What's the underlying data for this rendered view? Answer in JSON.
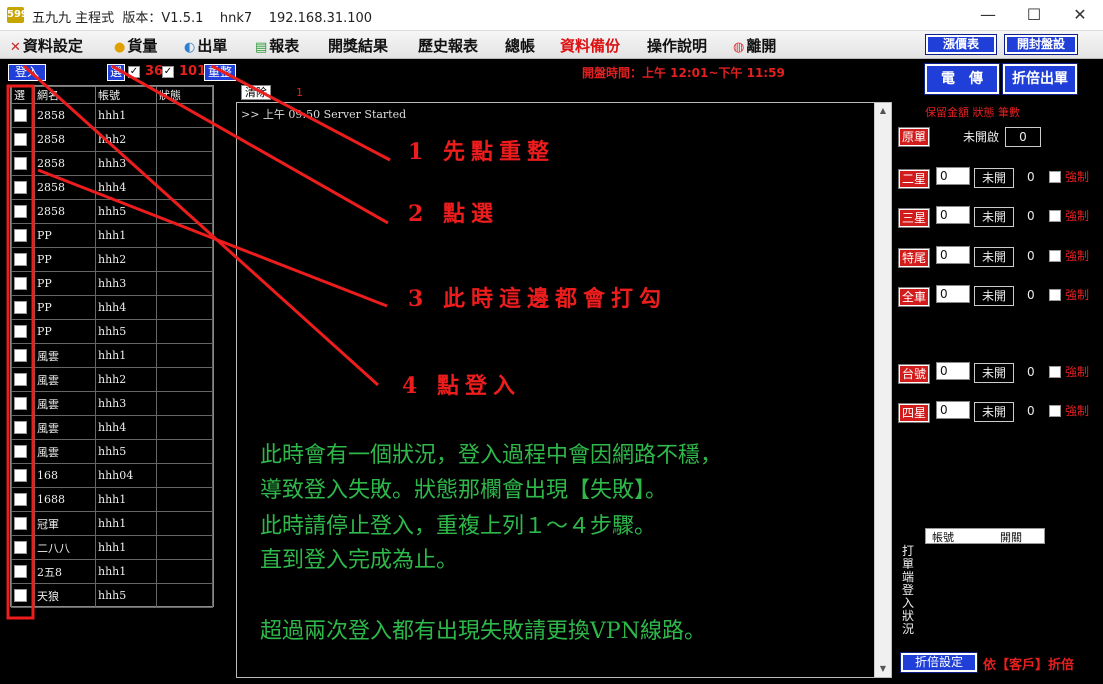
{
  "window": {
    "title": "五九九 主程式  版本：V1.5.1    hnk7    192.168.31.100",
    "app_icon": "599"
  },
  "menu": [
    {
      "label": "資料設定",
      "icon": "✕",
      "icon_color": "#c62828"
    },
    {
      "label": "貨量",
      "icon": "●",
      "icon_color": "#e0a000"
    },
    {
      "label": "出單",
      "icon": "◐",
      "icon_color": "#2d7fd3"
    },
    {
      "label": "報表",
      "icon": "▤",
      "icon_color": "#2e9b3a"
    },
    {
      "label": "開獎結果",
      "icon": "",
      "icon_color": ""
    },
    {
      "label": "歷史報表",
      "icon": "",
      "icon_color": ""
    },
    {
      "label": "總帳",
      "icon": "",
      "icon_color": ""
    },
    {
      "label": "資料備份",
      "icon": "",
      "icon_color": "",
      "color": "#d11"
    },
    {
      "label": "操作說明",
      "icon": "",
      "icon_color": ""
    },
    {
      "label": "離開",
      "icon": "◍",
      "icon_color": "#d33"
    }
  ],
  "top_right_buttons": {
    "limit_table": "漲價表",
    "seal_settings": "開封盤設"
  },
  "toolbar": {
    "login": "登入",
    "select": "選",
    "count_a": "36",
    "count_b": "101",
    "refresh": "重整",
    "clear": "清除",
    "clear_count": "1",
    "open_time": "開盤時間：上午 12:01~下午 11:59"
  },
  "grid": {
    "headers": [
      "選",
      "網名",
      "帳號",
      "狀態"
    ],
    "rows": [
      {
        "site": "2858",
        "account": "hhh1",
        "status": ""
      },
      {
        "site": "2858",
        "account": "hhh2",
        "status": ""
      },
      {
        "site": "2858",
        "account": "hhh3",
        "status": ""
      },
      {
        "site": "2858",
        "account": "hhh4",
        "status": ""
      },
      {
        "site": "2858",
        "account": "hhh5",
        "status": ""
      },
      {
        "site": "PP",
        "account": "hhh1",
        "status": ""
      },
      {
        "site": "PP",
        "account": "hhh2",
        "status": ""
      },
      {
        "site": "PP",
        "account": "hhh3",
        "status": ""
      },
      {
        "site": "PP",
        "account": "hhh4",
        "status": ""
      },
      {
        "site": "PP",
        "account": "hhh5",
        "status": ""
      },
      {
        "site": "風雲",
        "account": "hhh1",
        "status": ""
      },
      {
        "site": "風雲",
        "account": "hhh2",
        "status": ""
      },
      {
        "site": "風雲",
        "account": "hhh3",
        "status": ""
      },
      {
        "site": "風雲",
        "account": "hhh4",
        "status": ""
      },
      {
        "site": "風雲",
        "account": "hhh5",
        "status": ""
      },
      {
        "site": "168",
        "account": "hhh04",
        "status": ""
      },
      {
        "site": "1688",
        "account": "hhh1",
        "status": ""
      },
      {
        "site": "冠軍",
        "account": "hhh1",
        "status": ""
      },
      {
        "site": "二八八",
        "account": "hhh1",
        "status": ""
      },
      {
        "site": "2五8",
        "account": "hhh1",
        "status": ""
      },
      {
        "site": "天狼",
        "account": "hhh5",
        "status": ""
      }
    ]
  },
  "log": {
    "line": ">> 上午 09:50 Server Started"
  },
  "annotations": {
    "step1": "1  先點重整",
    "step2": "2  點選",
    "step3": "3  此時這邊都會打勾",
    "step4": "4  點登入"
  },
  "notes": [
    "此時會有一個狀況，登入過程中會因網路不穩，",
    "導致登入失敗。狀態那欄會出現【失敗】。",
    "此時請停止登入，重複上列１～４步驟。",
    "直到登入完成為止。",
    "超過兩次登入都有出現失敗請更換VPN線路。"
  ],
  "right_panel": {
    "transmit": "電　傳",
    "split_order": "折倍出單",
    "header_labels": "保留金額  狀態  筆數",
    "pending_label": "未開啟",
    "pending_value": "0",
    "rows": [
      {
        "label": "原單",
        "value": "",
        "status": "",
        "count": "",
        "force": ""
      },
      {
        "label": "二星",
        "value": "0",
        "status": "未開",
        "count": "0",
        "force": "強制"
      },
      {
        "label": "三星",
        "value": "0",
        "status": "未開",
        "count": "0",
        "force": "強制"
      },
      {
        "label": "特尾",
        "value": "0",
        "status": "未開",
        "count": "0",
        "force": "強制"
      },
      {
        "label": "全車",
        "value": "0",
        "status": "未開",
        "count": "0",
        "force": "強制"
      },
      {
        "label": "台號",
        "value": "0",
        "status": "未開",
        "count": "0",
        "force": "強制"
      },
      {
        "label": "四星",
        "value": "0",
        "status": "未開",
        "count": "0",
        "force": "強制"
      }
    ],
    "mini_table_headers": [
      "帳號",
      "開關"
    ],
    "vertical_label": "打單端登入狀況",
    "split_settings": "折倍設定",
    "client_split": "依【客戶】折倍"
  },
  "colors": {
    "accent_blue": "#1f3fd8",
    "alert_red": "#e32020",
    "note_green": "#2fb84a"
  }
}
